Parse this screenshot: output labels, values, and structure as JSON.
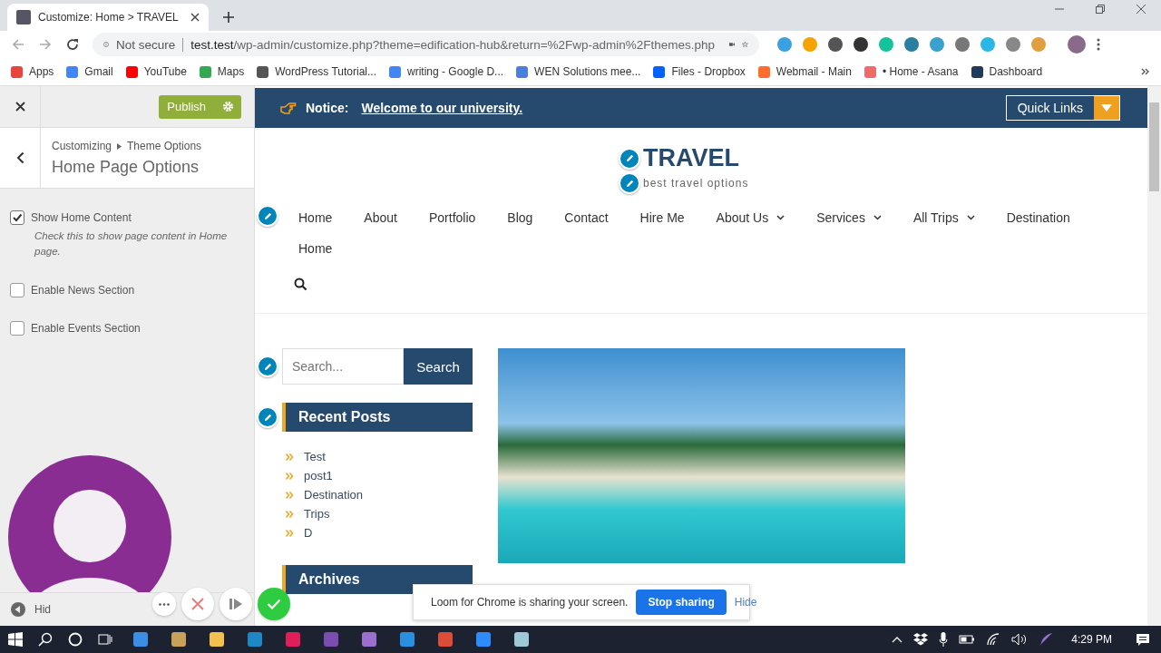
{
  "browser": {
    "tab_title": "Customize: Home > TRAVEL",
    "security": "Not secure",
    "url_host": "test.test",
    "url_path": "/wp-admin/customize.php?theme=edification-hub&return=%2Fwp-admin%2Fthemes.php",
    "bookmarks": [
      {
        "label": "Apps",
        "color": "#e8453c"
      },
      {
        "label": "Gmail",
        "color": "#4285f4"
      },
      {
        "label": "YouTube",
        "color": "#ff0000"
      },
      {
        "label": "Maps",
        "color": "#34a853"
      },
      {
        "label": "WordPress Tutorial...",
        "color": "#555555"
      },
      {
        "label": "writing - Google D...",
        "color": "#4285f4"
      },
      {
        "label": "WEN Solutions mee...",
        "color": "#4a7fe0"
      },
      {
        "label": "Files - Dropbox",
        "color": "#0061fe"
      },
      {
        "label": "Webmail - Main",
        "color": "#ff6c2c"
      },
      {
        "label": "• Home - Asana",
        "color": "#f06a6a"
      },
      {
        "label": "Dashboard",
        "color": "#1f3a5a"
      }
    ]
  },
  "customizer": {
    "publish": "Publish",
    "breadcrumb": [
      "Customizing",
      "Theme Options"
    ],
    "title": "Home Page Options",
    "options": [
      {
        "label": "Show Home Content",
        "checked": true,
        "description": "Check this to show page content in Home page."
      },
      {
        "label": "Enable News Section",
        "checked": false
      },
      {
        "label": "Enable Events Section",
        "checked": false
      }
    ],
    "hide_label": "Hid"
  },
  "preview": {
    "notice_label": "Notice:",
    "notice_text": "Welcome to our university.",
    "quick_links": "Quick Links",
    "site_title": "TRAVEL",
    "tagline": "best travel options",
    "nav": [
      {
        "label": "Home",
        "dropdown": false
      },
      {
        "label": "About",
        "dropdown": false
      },
      {
        "label": "Portfolio",
        "dropdown": false
      },
      {
        "label": "Blog",
        "dropdown": false
      },
      {
        "label": "Contact",
        "dropdown": false
      },
      {
        "label": "Hire Me",
        "dropdown": false
      },
      {
        "label": "About Us",
        "dropdown": true
      },
      {
        "label": "Services",
        "dropdown": true
      },
      {
        "label": "All Trips",
        "dropdown": true
      },
      {
        "label": "Destination",
        "dropdown": false
      },
      {
        "label": "Home",
        "dropdown": false
      }
    ],
    "search_placeholder": "Search...",
    "search_button": "Search",
    "recent_posts_title": "Recent Posts",
    "recent_posts": [
      "Test",
      "post1",
      "Destination",
      "Trips",
      "D"
    ],
    "archives_title": "Archives"
  },
  "loom": {
    "notification": "Loom for Chrome is sharing your screen.",
    "stop": "Stop sharing",
    "hide": "Hide"
  },
  "taskbar": {
    "time": "4:29 PM"
  }
}
